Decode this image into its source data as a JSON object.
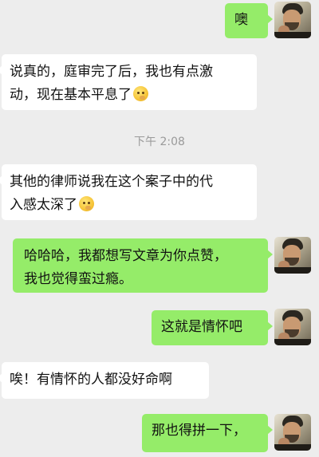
{
  "timestamp": "下午 2:08",
  "emoji": "thinking-face",
  "messages": [
    {
      "sender": "me",
      "text": "噢"
    },
    {
      "sender": "other",
      "line1": "说真的，庭审完了后，我也有点激",
      "line2": "动，现在基本平息了"
    },
    {
      "sender": "other",
      "line1": "其他的律师说我在这个案子中的代",
      "line2": "入感太深了"
    },
    {
      "sender": "me",
      "line1": "哈哈哈，我都想写文章为你点赞，",
      "line2": "我也觉得蛮过瘾。"
    },
    {
      "sender": "me",
      "text": "这就是情怀吧"
    },
    {
      "sender": "other",
      "text": "唉！有情怀的人都没好命啊"
    },
    {
      "sender": "me",
      "text": "那也得拼一下，"
    }
  ]
}
